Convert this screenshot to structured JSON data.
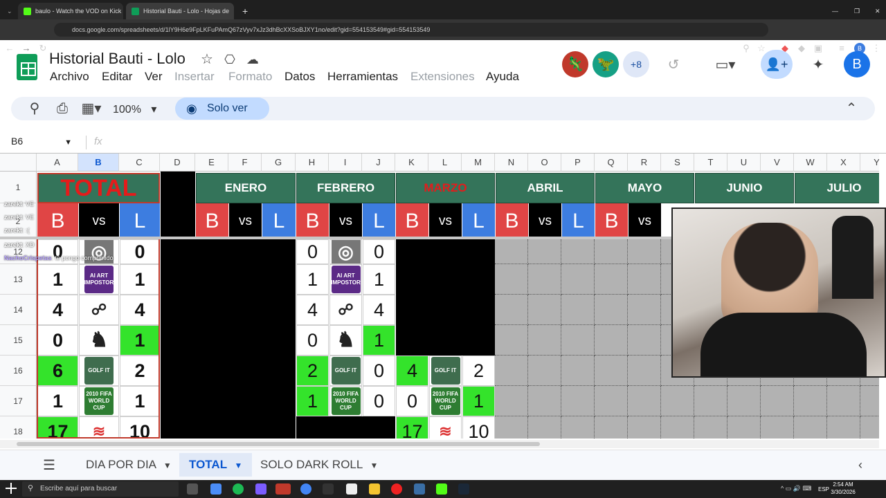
{
  "browser": {
    "tabs": [
      {
        "title": "baulo - Watch the VOD on Kick",
        "color": "#53fc18"
      },
      {
        "title": "Historial Bauti - Lolo - Hojas de",
        "color": "#0f9d58"
      }
    ],
    "url": "docs.google.com/spreadsheets/d/1lY9H6e9FpLKFuPAmQ67zVyv7xJz3dhBcXXSoBJXY1no/edit?gid=554153549#gid=554153549"
  },
  "doc": {
    "title": "Historial Bauti - Lolo",
    "menus": [
      {
        "label": "Archivo",
        "disabled": false
      },
      {
        "label": "Editar",
        "disabled": false
      },
      {
        "label": "Ver",
        "disabled": false
      },
      {
        "label": "Insertar",
        "disabled": true
      },
      {
        "label": "Formato",
        "disabled": true
      },
      {
        "label": "Datos",
        "disabled": false
      },
      {
        "label": "Herramientas",
        "disabled": false
      },
      {
        "label": "Extensiones",
        "disabled": true
      },
      {
        "label": "Ayuda",
        "disabled": false
      }
    ],
    "extra_users": "+8",
    "avatar_letter": "B"
  },
  "toolbar": {
    "zoom": "100%",
    "view_mode": "Solo ver"
  },
  "namebox": "B6",
  "fx": "fx",
  "columns": [
    "A",
    "B",
    "C",
    "D",
    "E",
    "F",
    "G",
    "H",
    "I",
    "J",
    "K",
    "L",
    "M",
    "N",
    "O",
    "P",
    "Q",
    "R",
    "S",
    "T",
    "U",
    "V",
    "W",
    "X",
    "Y"
  ],
  "rows": [
    "1",
    "2",
    "12",
    "13",
    "14",
    "15",
    "16",
    "17",
    "18"
  ],
  "header": {
    "total": "TOTAL",
    "months": [
      "ENERO",
      "FEBRERO",
      "MARZO",
      "ABRIL",
      "MAYO",
      "JUNIO",
      "JULIO"
    ],
    "b": "B",
    "vs": "vs",
    "l": "L"
  },
  "games": [
    {
      "row": "12",
      "icon": "spin-icon",
      "label": "",
      "total": [
        "0",
        "0"
      ],
      "feb": [
        "0",
        "0"
      ],
      "mar": null
    },
    {
      "row": "13",
      "icon": "art-impostor-icon",
      "label": "AI ART IMPOSTOR",
      "total": [
        "1",
        "1"
      ],
      "feb": [
        "1",
        "1"
      ],
      "mar": null
    },
    {
      "row": "14",
      "icon": "wrestling-icon",
      "label": "",
      "total": [
        "4",
        "4"
      ],
      "feb": [
        "4",
        "4"
      ],
      "mar": null
    },
    {
      "row": "15",
      "icon": "chess-knight-icon",
      "label": "♞",
      "total": [
        "0",
        "1"
      ],
      "feb": [
        "0",
        "1"
      ],
      "mar": null
    },
    {
      "row": "16",
      "icon": "golf-it-icon",
      "label": "GOLF IT",
      "total": [
        "6",
        "2"
      ],
      "feb": [
        "2",
        "0"
      ],
      "mar": [
        "4",
        "2"
      ]
    },
    {
      "row": "17",
      "icon": "fifa-2010-icon",
      "label": "2010 FIFA WORLD CUP",
      "total": [
        "1",
        "1"
      ],
      "feb": [
        "1",
        "0"
      ],
      "mar": [
        "0",
        "1"
      ]
    },
    {
      "row": "18",
      "icon": "wave-icon",
      "label": "",
      "total": [
        "17",
        "10"
      ],
      "feb": null,
      "mar": [
        "17",
        "10"
      ]
    }
  ],
  "chat": [
    {
      "user": "zarekt",
      "text": ": VE"
    },
    {
      "user": "zarekt",
      "text": ": VE"
    },
    {
      "user": "zarekt",
      "text": ": :("
    },
    {
      "user": "zarekt",
      "text": ": XD"
    },
    {
      "user": "NachoCrispetas",
      "text": ": te pongo comprimido"
    }
  ],
  "sheet_tabs": [
    "DIA POR DIA",
    "TOTAL",
    "SOLO DARK ROLL"
  ],
  "active_sheet": "TOTAL",
  "taskbar": {
    "search_placeholder": "Escribe aquí para buscar",
    "lang": "ESP",
    "time": "2:54 AM",
    "date": "3/30/2026"
  },
  "colors": {
    "green_win": "#34e32b",
    "month_green": "#34745a",
    "b_red": "#e04545",
    "l_blue": "#3d7de0"
  }
}
